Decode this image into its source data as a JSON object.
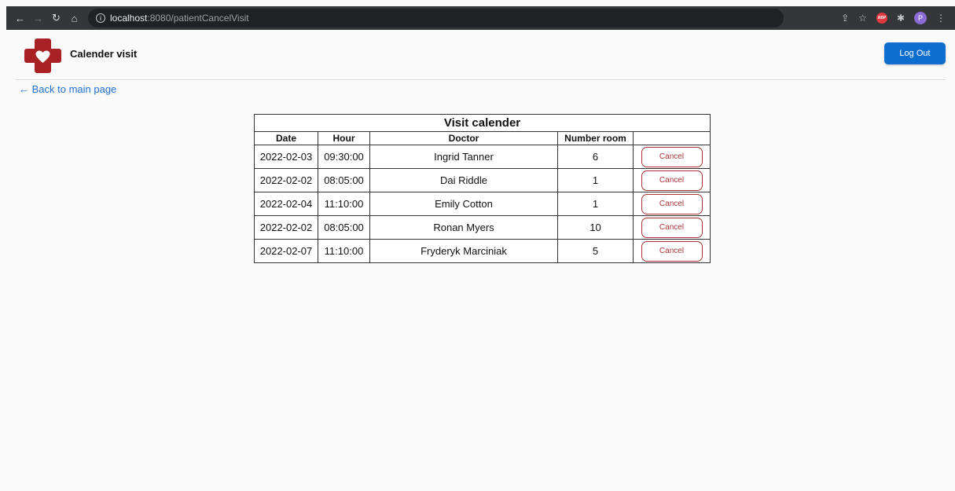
{
  "browser": {
    "url_host": "localhost",
    "url_rest": ":8080/patientCancelVisit",
    "profile_initial": "P",
    "abp_label": "ABP"
  },
  "header": {
    "title": "Calender visit",
    "logout_label": "Log Out"
  },
  "nav": {
    "back_label": "← Back to main page"
  },
  "table": {
    "caption": "Visit calender",
    "columns": [
      "Date",
      "Hour",
      "Doctor",
      "Number room",
      ""
    ],
    "rows": [
      {
        "date": "2022-02-03",
        "hour": "09:30:00",
        "doctor": "Ingrid Tanner",
        "room": "6",
        "action": "Cancel"
      },
      {
        "date": "2022-02-02",
        "hour": "08:05:00",
        "doctor": "Dai Riddle",
        "room": "1",
        "action": "Cancel"
      },
      {
        "date": "2022-02-04",
        "hour": "11:10:00",
        "doctor": "Emily Cotton",
        "room": "1",
        "action": "Cancel"
      },
      {
        "date": "2022-02-02",
        "hour": "08:05:00",
        "doctor": "Ronan Myers",
        "room": "10",
        "action": "Cancel"
      },
      {
        "date": "2022-02-07",
        "hour": "11:10:00",
        "doctor": "Fryderyk Marciniak",
        "room": "5",
        "action": "Cancel"
      }
    ]
  },
  "colors": {
    "accent": "#0d6ecf",
    "cancel": "#a83236",
    "logo": "#a82124"
  }
}
